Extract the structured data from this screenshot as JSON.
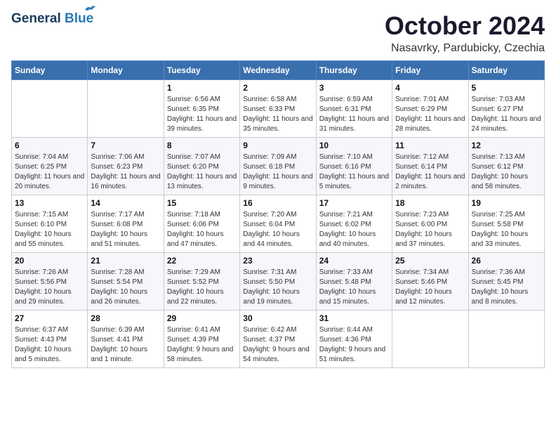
{
  "header": {
    "logo_line1": "General",
    "logo_line2": "Blue",
    "month": "October 2024",
    "location": "Nasavrky, Pardubicky, Czechia"
  },
  "weekdays": [
    "Sunday",
    "Monday",
    "Tuesday",
    "Wednesday",
    "Thursday",
    "Friday",
    "Saturday"
  ],
  "weeks": [
    [
      {
        "day": "",
        "sunrise": "",
        "sunset": "",
        "daylight": ""
      },
      {
        "day": "",
        "sunrise": "",
        "sunset": "",
        "daylight": ""
      },
      {
        "day": "1",
        "sunrise": "Sunrise: 6:56 AM",
        "sunset": "Sunset: 6:35 PM",
        "daylight": "Daylight: 11 hours and 39 minutes."
      },
      {
        "day": "2",
        "sunrise": "Sunrise: 6:58 AM",
        "sunset": "Sunset: 6:33 PM",
        "daylight": "Daylight: 11 hours and 35 minutes."
      },
      {
        "day": "3",
        "sunrise": "Sunrise: 6:59 AM",
        "sunset": "Sunset: 6:31 PM",
        "daylight": "Daylight: 11 hours and 31 minutes."
      },
      {
        "day": "4",
        "sunrise": "Sunrise: 7:01 AM",
        "sunset": "Sunset: 6:29 PM",
        "daylight": "Daylight: 11 hours and 28 minutes."
      },
      {
        "day": "5",
        "sunrise": "Sunrise: 7:03 AM",
        "sunset": "Sunset: 6:27 PM",
        "daylight": "Daylight: 11 hours and 24 minutes."
      }
    ],
    [
      {
        "day": "6",
        "sunrise": "Sunrise: 7:04 AM",
        "sunset": "Sunset: 6:25 PM",
        "daylight": "Daylight: 11 hours and 20 minutes."
      },
      {
        "day": "7",
        "sunrise": "Sunrise: 7:06 AM",
        "sunset": "Sunset: 6:23 PM",
        "daylight": "Daylight: 11 hours and 16 minutes."
      },
      {
        "day": "8",
        "sunrise": "Sunrise: 7:07 AM",
        "sunset": "Sunset: 6:20 PM",
        "daylight": "Daylight: 11 hours and 13 minutes."
      },
      {
        "day": "9",
        "sunrise": "Sunrise: 7:09 AM",
        "sunset": "Sunset: 6:18 PM",
        "daylight": "Daylight: 11 hours and 9 minutes."
      },
      {
        "day": "10",
        "sunrise": "Sunrise: 7:10 AM",
        "sunset": "Sunset: 6:16 PM",
        "daylight": "Daylight: 11 hours and 5 minutes."
      },
      {
        "day": "11",
        "sunrise": "Sunrise: 7:12 AM",
        "sunset": "Sunset: 6:14 PM",
        "daylight": "Daylight: 11 hours and 2 minutes."
      },
      {
        "day": "12",
        "sunrise": "Sunrise: 7:13 AM",
        "sunset": "Sunset: 6:12 PM",
        "daylight": "Daylight: 10 hours and 58 minutes."
      }
    ],
    [
      {
        "day": "13",
        "sunrise": "Sunrise: 7:15 AM",
        "sunset": "Sunset: 6:10 PM",
        "daylight": "Daylight: 10 hours and 55 minutes."
      },
      {
        "day": "14",
        "sunrise": "Sunrise: 7:17 AM",
        "sunset": "Sunset: 6:08 PM",
        "daylight": "Daylight: 10 hours and 51 minutes."
      },
      {
        "day": "15",
        "sunrise": "Sunrise: 7:18 AM",
        "sunset": "Sunset: 6:06 PM",
        "daylight": "Daylight: 10 hours and 47 minutes."
      },
      {
        "day": "16",
        "sunrise": "Sunrise: 7:20 AM",
        "sunset": "Sunset: 6:04 PM",
        "daylight": "Daylight: 10 hours and 44 minutes."
      },
      {
        "day": "17",
        "sunrise": "Sunrise: 7:21 AM",
        "sunset": "Sunset: 6:02 PM",
        "daylight": "Daylight: 10 hours and 40 minutes."
      },
      {
        "day": "18",
        "sunrise": "Sunrise: 7:23 AM",
        "sunset": "Sunset: 6:00 PM",
        "daylight": "Daylight: 10 hours and 37 minutes."
      },
      {
        "day": "19",
        "sunrise": "Sunrise: 7:25 AM",
        "sunset": "Sunset: 5:58 PM",
        "daylight": "Daylight: 10 hours and 33 minutes."
      }
    ],
    [
      {
        "day": "20",
        "sunrise": "Sunrise: 7:26 AM",
        "sunset": "Sunset: 5:56 PM",
        "daylight": "Daylight: 10 hours and 29 minutes."
      },
      {
        "day": "21",
        "sunrise": "Sunrise: 7:28 AM",
        "sunset": "Sunset: 5:54 PM",
        "daylight": "Daylight: 10 hours and 26 minutes."
      },
      {
        "day": "22",
        "sunrise": "Sunrise: 7:29 AM",
        "sunset": "Sunset: 5:52 PM",
        "daylight": "Daylight: 10 hours and 22 minutes."
      },
      {
        "day": "23",
        "sunrise": "Sunrise: 7:31 AM",
        "sunset": "Sunset: 5:50 PM",
        "daylight": "Daylight: 10 hours and 19 minutes."
      },
      {
        "day": "24",
        "sunrise": "Sunrise: 7:33 AM",
        "sunset": "Sunset: 5:48 PM",
        "daylight": "Daylight: 10 hours and 15 minutes."
      },
      {
        "day": "25",
        "sunrise": "Sunrise: 7:34 AM",
        "sunset": "Sunset: 5:46 PM",
        "daylight": "Daylight: 10 hours and 12 minutes."
      },
      {
        "day": "26",
        "sunrise": "Sunrise: 7:36 AM",
        "sunset": "Sunset: 5:45 PM",
        "daylight": "Daylight: 10 hours and 8 minutes."
      }
    ],
    [
      {
        "day": "27",
        "sunrise": "Sunrise: 6:37 AM",
        "sunset": "Sunset: 4:43 PM",
        "daylight": "Daylight: 10 hours and 5 minutes."
      },
      {
        "day": "28",
        "sunrise": "Sunrise: 6:39 AM",
        "sunset": "Sunset: 4:41 PM",
        "daylight": "Daylight: 10 hours and 1 minute."
      },
      {
        "day": "29",
        "sunrise": "Sunrise: 6:41 AM",
        "sunset": "Sunset: 4:39 PM",
        "daylight": "Daylight: 9 hours and 58 minutes."
      },
      {
        "day": "30",
        "sunrise": "Sunrise: 6:42 AM",
        "sunset": "Sunset: 4:37 PM",
        "daylight": "Daylight: 9 hours and 54 minutes."
      },
      {
        "day": "31",
        "sunrise": "Sunrise: 6:44 AM",
        "sunset": "Sunset: 4:36 PM",
        "daylight": "Daylight: 9 hours and 51 minutes."
      },
      {
        "day": "",
        "sunrise": "",
        "sunset": "",
        "daylight": ""
      },
      {
        "day": "",
        "sunrise": "",
        "sunset": "",
        "daylight": ""
      }
    ]
  ]
}
